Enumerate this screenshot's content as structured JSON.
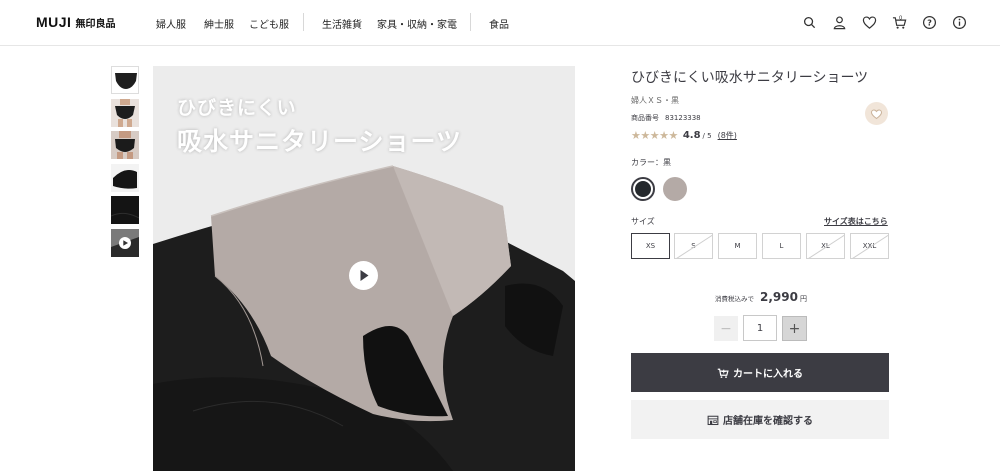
{
  "header": {
    "logo_brand": "MUJI",
    "logo_jp": "無印良品",
    "nav": [
      "婦人服",
      "紳士服",
      "こども服",
      "生活雑貨",
      "家具・収納・家電",
      "食品"
    ],
    "icons": [
      "search-icon",
      "user-icon",
      "heart-icon",
      "cart-icon",
      "help-icon",
      "info-icon"
    ],
    "cart_count": "0"
  },
  "gallery": {
    "thumbnails": [
      "thumb-1",
      "thumb-2",
      "thumb-3",
      "thumb-4",
      "thumb-5",
      "thumb-video"
    ],
    "hero_line1": "ひびきにくい",
    "hero_line2": "吸水サニタリーショーツ"
  },
  "product": {
    "title": "ひびきにくい吸水サニタリーショーツ",
    "subtitle": "婦人ＸＳ・黒",
    "product_no_label": "商品番号",
    "product_no": "83123338",
    "rating_stars": "★★★★★",
    "rating": "4.8",
    "rating_outof": "/ 5",
    "review_count": "(8件)",
    "color_label": "カラー：黒",
    "colors": [
      "#25292d",
      "#b4aaa6"
    ],
    "size_label": "サイズ",
    "size_chart_link": "サイズ表はこちら",
    "sizes": [
      "XS",
      "S",
      "M",
      "L",
      "XL",
      "XXL"
    ],
    "price_tax_label": "消費税込みで",
    "price": "2,990",
    "price_unit": "円",
    "quantity": "1",
    "qty_minus": "−",
    "qty_plus": "+",
    "cart_button": "カートに入れる",
    "store_button": "店舗在庫を確認する"
  },
  "colors": {
    "primary": "#3c3c43",
    "accent_beige": "#cdb89b",
    "fav_bg": "#f1e5d9"
  }
}
